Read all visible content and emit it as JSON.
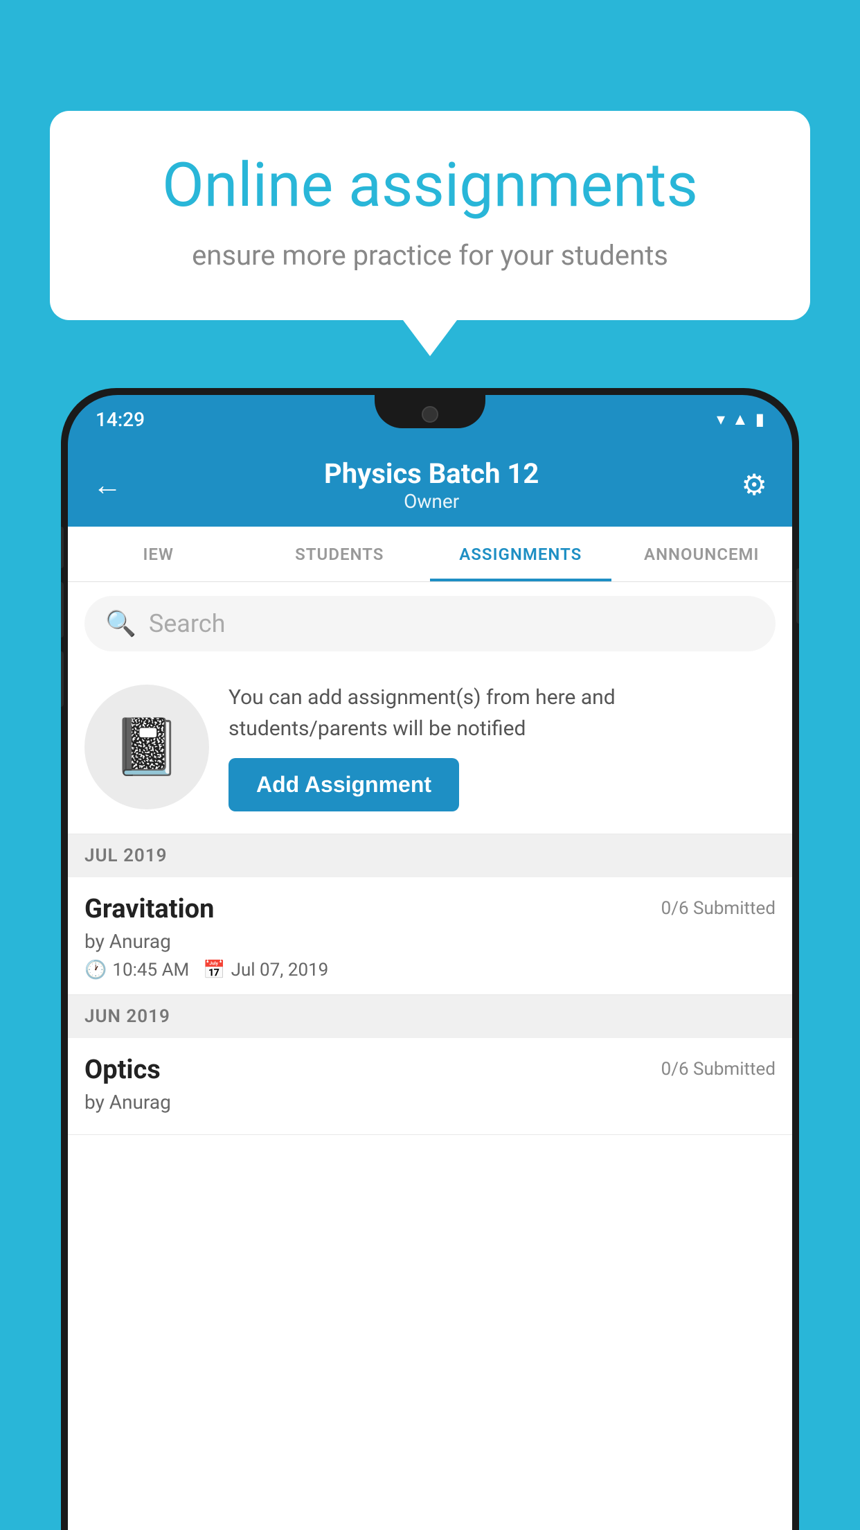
{
  "background": {
    "color": "#29b6d8"
  },
  "speech_bubble": {
    "title": "Online assignments",
    "subtitle": "ensure more practice for your students"
  },
  "status_bar": {
    "time": "14:29",
    "icons": [
      "wifi",
      "signal",
      "battery"
    ]
  },
  "app_bar": {
    "back_label": "←",
    "title": "Physics Batch 12",
    "subtitle": "Owner",
    "settings_label": "⚙"
  },
  "tabs": [
    {
      "label": "IEW",
      "active": false
    },
    {
      "label": "STUDENTS",
      "active": false
    },
    {
      "label": "ASSIGNMENTS",
      "active": true
    },
    {
      "label": "ANNOUNCEMENTS",
      "active": false
    }
  ],
  "search": {
    "placeholder": "Search"
  },
  "promo": {
    "text": "You can add assignment(s) from here and students/parents will be notified",
    "button_label": "Add Assignment"
  },
  "sections": [
    {
      "label": "JUL 2019",
      "assignments": [
        {
          "name": "Gravitation",
          "submitted": "0/6 Submitted",
          "by": "by Anurag",
          "time": "10:45 AM",
          "date": "Jul 07, 2019"
        }
      ]
    },
    {
      "label": "JUN 2019",
      "assignments": [
        {
          "name": "Optics",
          "submitted": "0/6 Submitted",
          "by": "by Anurag",
          "time": "",
          "date": ""
        }
      ]
    }
  ]
}
